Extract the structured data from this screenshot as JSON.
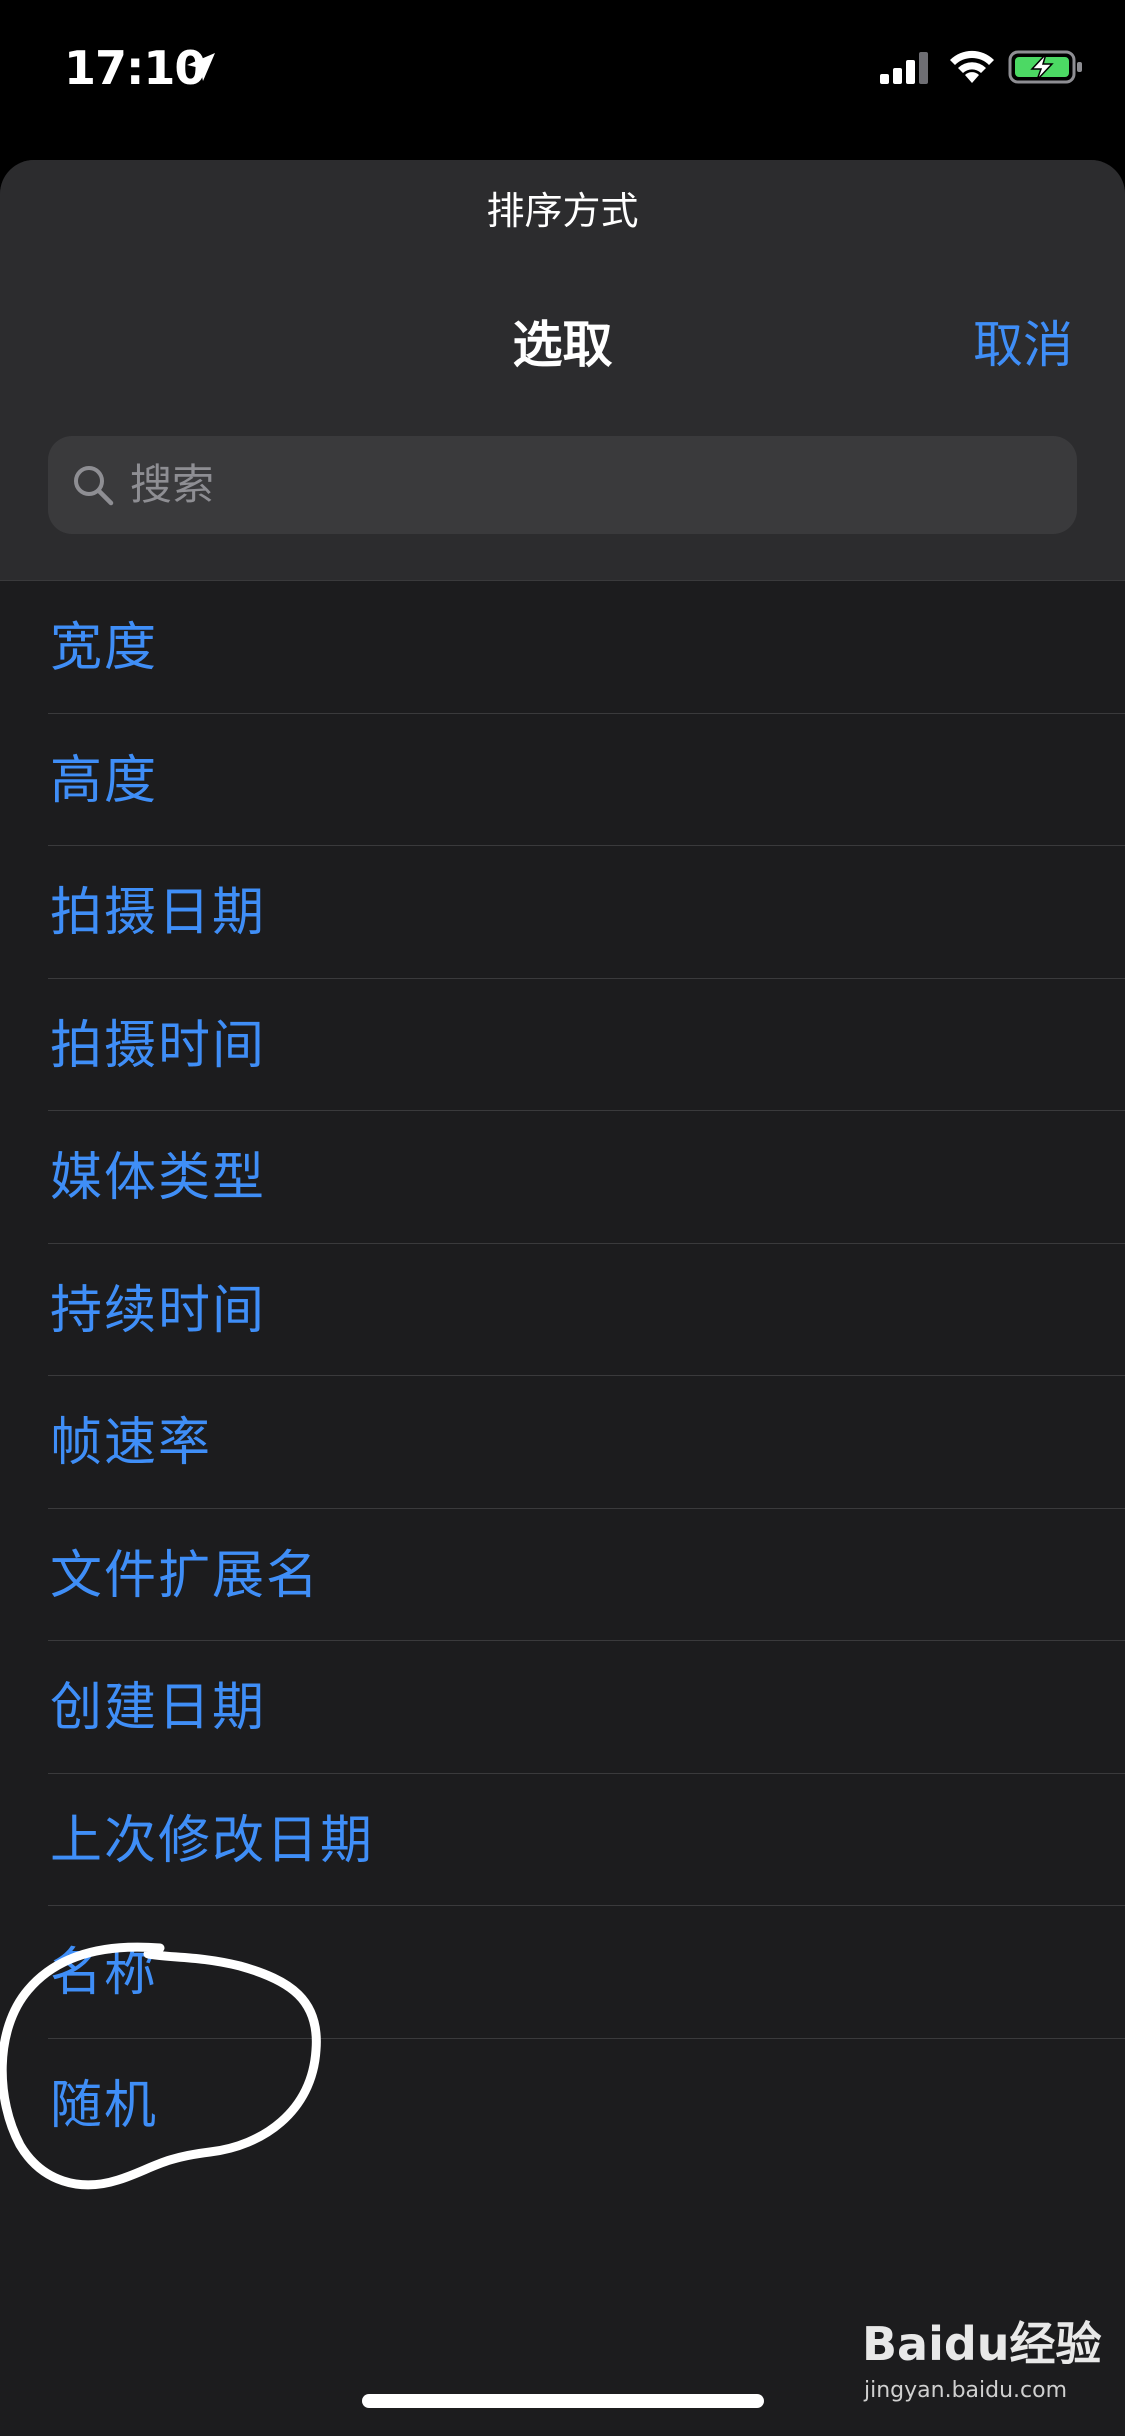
{
  "status_bar": {
    "time": "17:10",
    "icons": [
      "location-arrow-icon",
      "cellular-signal-icon",
      "wifi-icon",
      "battery-charging-icon"
    ],
    "battery_color": "#4cd964"
  },
  "sheet": {
    "subtitle": "排序方式",
    "title": "选取",
    "cancel_label": "取消",
    "search_placeholder": "搜索"
  },
  "options": [
    {
      "label": "宽度"
    },
    {
      "label": "高度"
    },
    {
      "label": "拍摄日期"
    },
    {
      "label": "拍摄时间"
    },
    {
      "label": "媒体类型"
    },
    {
      "label": "持续时间"
    },
    {
      "label": "帧速率"
    },
    {
      "label": "文件扩展名"
    },
    {
      "label": "创建日期"
    },
    {
      "label": "上次修改日期"
    },
    {
      "label": "名称"
    },
    {
      "label": "随机"
    }
  ],
  "watermark": {
    "logo": "Baidu经验",
    "url": "jingyan.baidu.com"
  },
  "colors": {
    "accent": "#3f8ef7",
    "sheet_background": "#1c1c1e",
    "header_background": "#2c2c2e",
    "search_background": "#3a3a3c"
  }
}
